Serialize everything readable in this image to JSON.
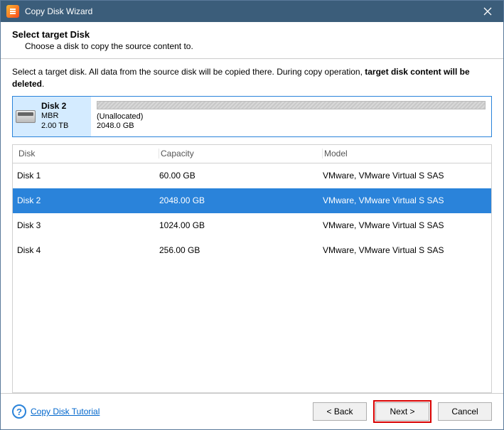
{
  "window": {
    "title": "Copy Disk Wizard"
  },
  "header": {
    "title": "Select target Disk",
    "subtitle": "Choose a disk to copy the source content to."
  },
  "instruction": {
    "prefix": "Select a target disk. All data from the source disk will be copied there. During copy operation, ",
    "bold": "target disk content will be deleted",
    "suffix": "."
  },
  "preview": {
    "name": "Disk 2",
    "scheme": "MBR",
    "size": "2.00 TB",
    "alloc_label": "(Unallocated)",
    "alloc_size": "2048.0 GB"
  },
  "table": {
    "headers": {
      "disk": "Disk",
      "capacity": "Capacity",
      "model": "Model"
    },
    "rows": [
      {
        "disk": "Disk 1",
        "capacity": "60.00 GB",
        "model": "VMware, VMware Virtual S SAS",
        "selected": false
      },
      {
        "disk": "Disk 2",
        "capacity": "2048.00 GB",
        "model": "VMware, VMware Virtual S SAS",
        "selected": true
      },
      {
        "disk": "Disk 3",
        "capacity": "1024.00 GB",
        "model": "VMware, VMware Virtual S SAS",
        "selected": false
      },
      {
        "disk": "Disk 4",
        "capacity": "256.00 GB",
        "model": "VMware, VMware Virtual S SAS",
        "selected": false
      }
    ]
  },
  "footer": {
    "tutorial": "Copy Disk Tutorial",
    "back": "< Back",
    "next": "Next >",
    "cancel": "Cancel"
  }
}
